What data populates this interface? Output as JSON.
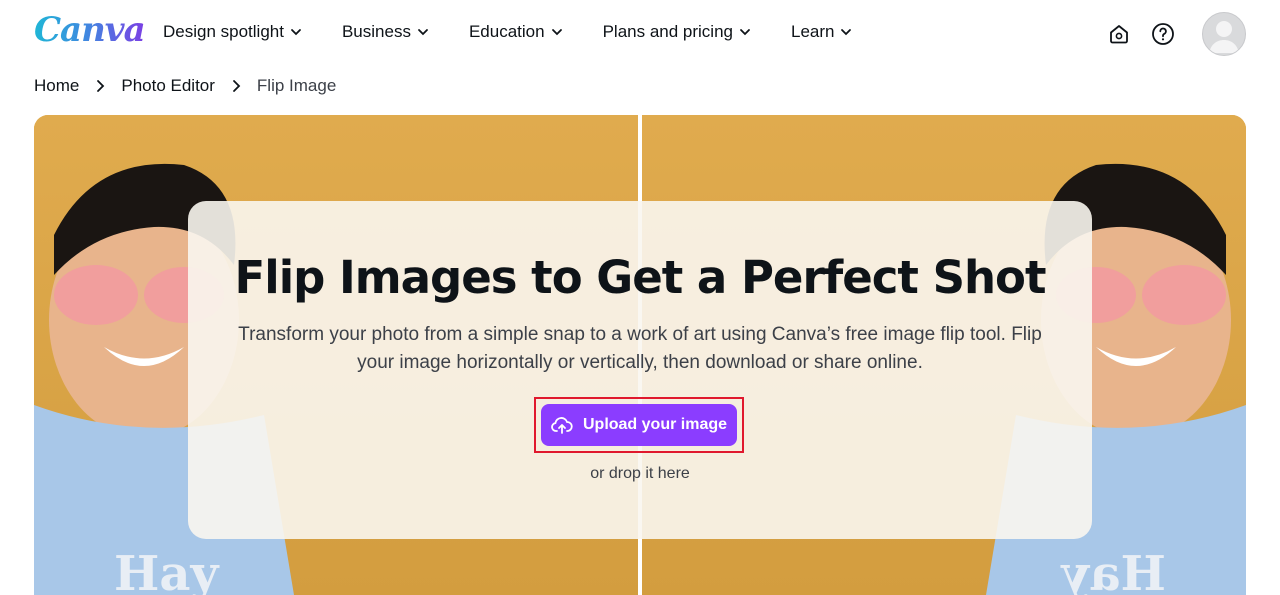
{
  "header": {
    "logo": "Canva",
    "menu": [
      {
        "label": "Design spotlight"
      },
      {
        "label": "Business"
      },
      {
        "label": "Education"
      },
      {
        "label": "Plans and pricing"
      },
      {
        "label": "Learn"
      }
    ],
    "icons": [
      "home-settings-icon",
      "help-icon",
      "avatar"
    ]
  },
  "breadcrumb": {
    "items": [
      "Home",
      "Photo Editor",
      "Flip Image"
    ]
  },
  "hero": {
    "title": "Flip Images to Get a Perfect Shot",
    "description": "Transform your photo from a simple snap to a work of art using Canva’s free image flip tool. Flip your image horizontally or vertically, then download or share online.",
    "upload_label": "Upload your image",
    "drop_text": "or drop it here",
    "colors": {
      "button": "#8b3dff",
      "highlight": "#e0182d",
      "background": "#d7a447"
    }
  }
}
